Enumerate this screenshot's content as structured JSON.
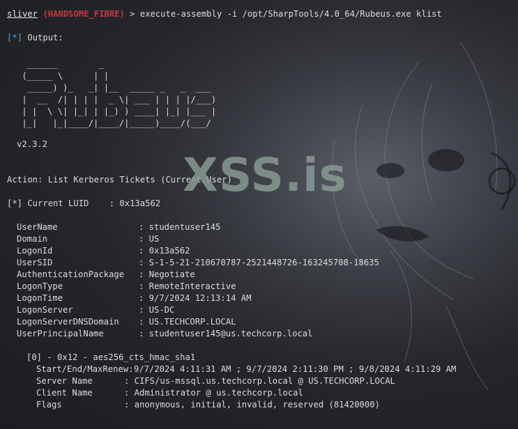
{
  "prompt": {
    "user": "sliver",
    "session": "(HANDSOME_FIBRE)",
    "command": "> execute-assembly -i /opt/SharpTools/4.0_64/Rubeus.exe klist"
  },
  "output_tag": "[*]",
  "output_label": "Output:",
  "banner_art": "  ______        _\n (_____ \\      | |\n  _____) )_   _| |__  _____ _   _  ___\n |  __  /| | | |  _ \\| ___ | | | |/___)\n | |  \\ \\| |_| | |_) ) ____| |_| |___ |\n |_|   |_|____/|____/|_____)____/(___/",
  "version": "v2.3.2",
  "action": "Action: List Kerberos Tickets (Current User)",
  "luid_line": "[*] Current LUID    : 0x13a562",
  "session_fields": [
    {
      "key": "UserName",
      "value": ": studentuser145"
    },
    {
      "key": "Domain",
      "value": ": US"
    },
    {
      "key": "LogonId",
      "value": ": 0x13a562"
    },
    {
      "key": "UserSID",
      "value": ": S-1-5-21-210670787-2521448726-163245708-18635"
    },
    {
      "key": "AuthenticationPackage",
      "value": ": Negotiate"
    },
    {
      "key": "LogonType",
      "value": ": RemoteInteractive"
    },
    {
      "key": "LogonTime",
      "value": ": 9/7/2024 12:13:14 AM"
    },
    {
      "key": "LogonServer",
      "value": ": US-DC"
    },
    {
      "key": "LogonServerDNSDomain",
      "value": ": US.TECHCORP.LOCAL"
    },
    {
      "key": "UserPrincipalName",
      "value": ": studentuser145@us.techcorp.local"
    }
  ],
  "ticket_header": "[0] - 0x12 - aes256_cts_hmac_sha1",
  "ticket_fields": [
    {
      "key": "Start/End/MaxRenew:",
      "value": "9/7/2024 4:11:31 AM ; 9/7/2024 2:11:30 PM ; 9/8/2024 4:11:29 AM"
    },
    {
      "key": "Server Name",
      "value": ": CIFS/us-mssql.us.techcorp.local @ US.TECHCORP.LOCAL"
    },
    {
      "key": "Client Name",
      "value": ": Administrator @ us.techcorp.local"
    },
    {
      "key": "Flags",
      "value": ": anonymous, initial, invalid, reserved (81420000)"
    }
  ],
  "watermark": "XSS.is",
  "colors": {
    "background": "#25262b",
    "text": "#dcdcdc",
    "session": "#c8383e",
    "tag": "#4ea2d8",
    "watermark": "#8a9d94"
  }
}
